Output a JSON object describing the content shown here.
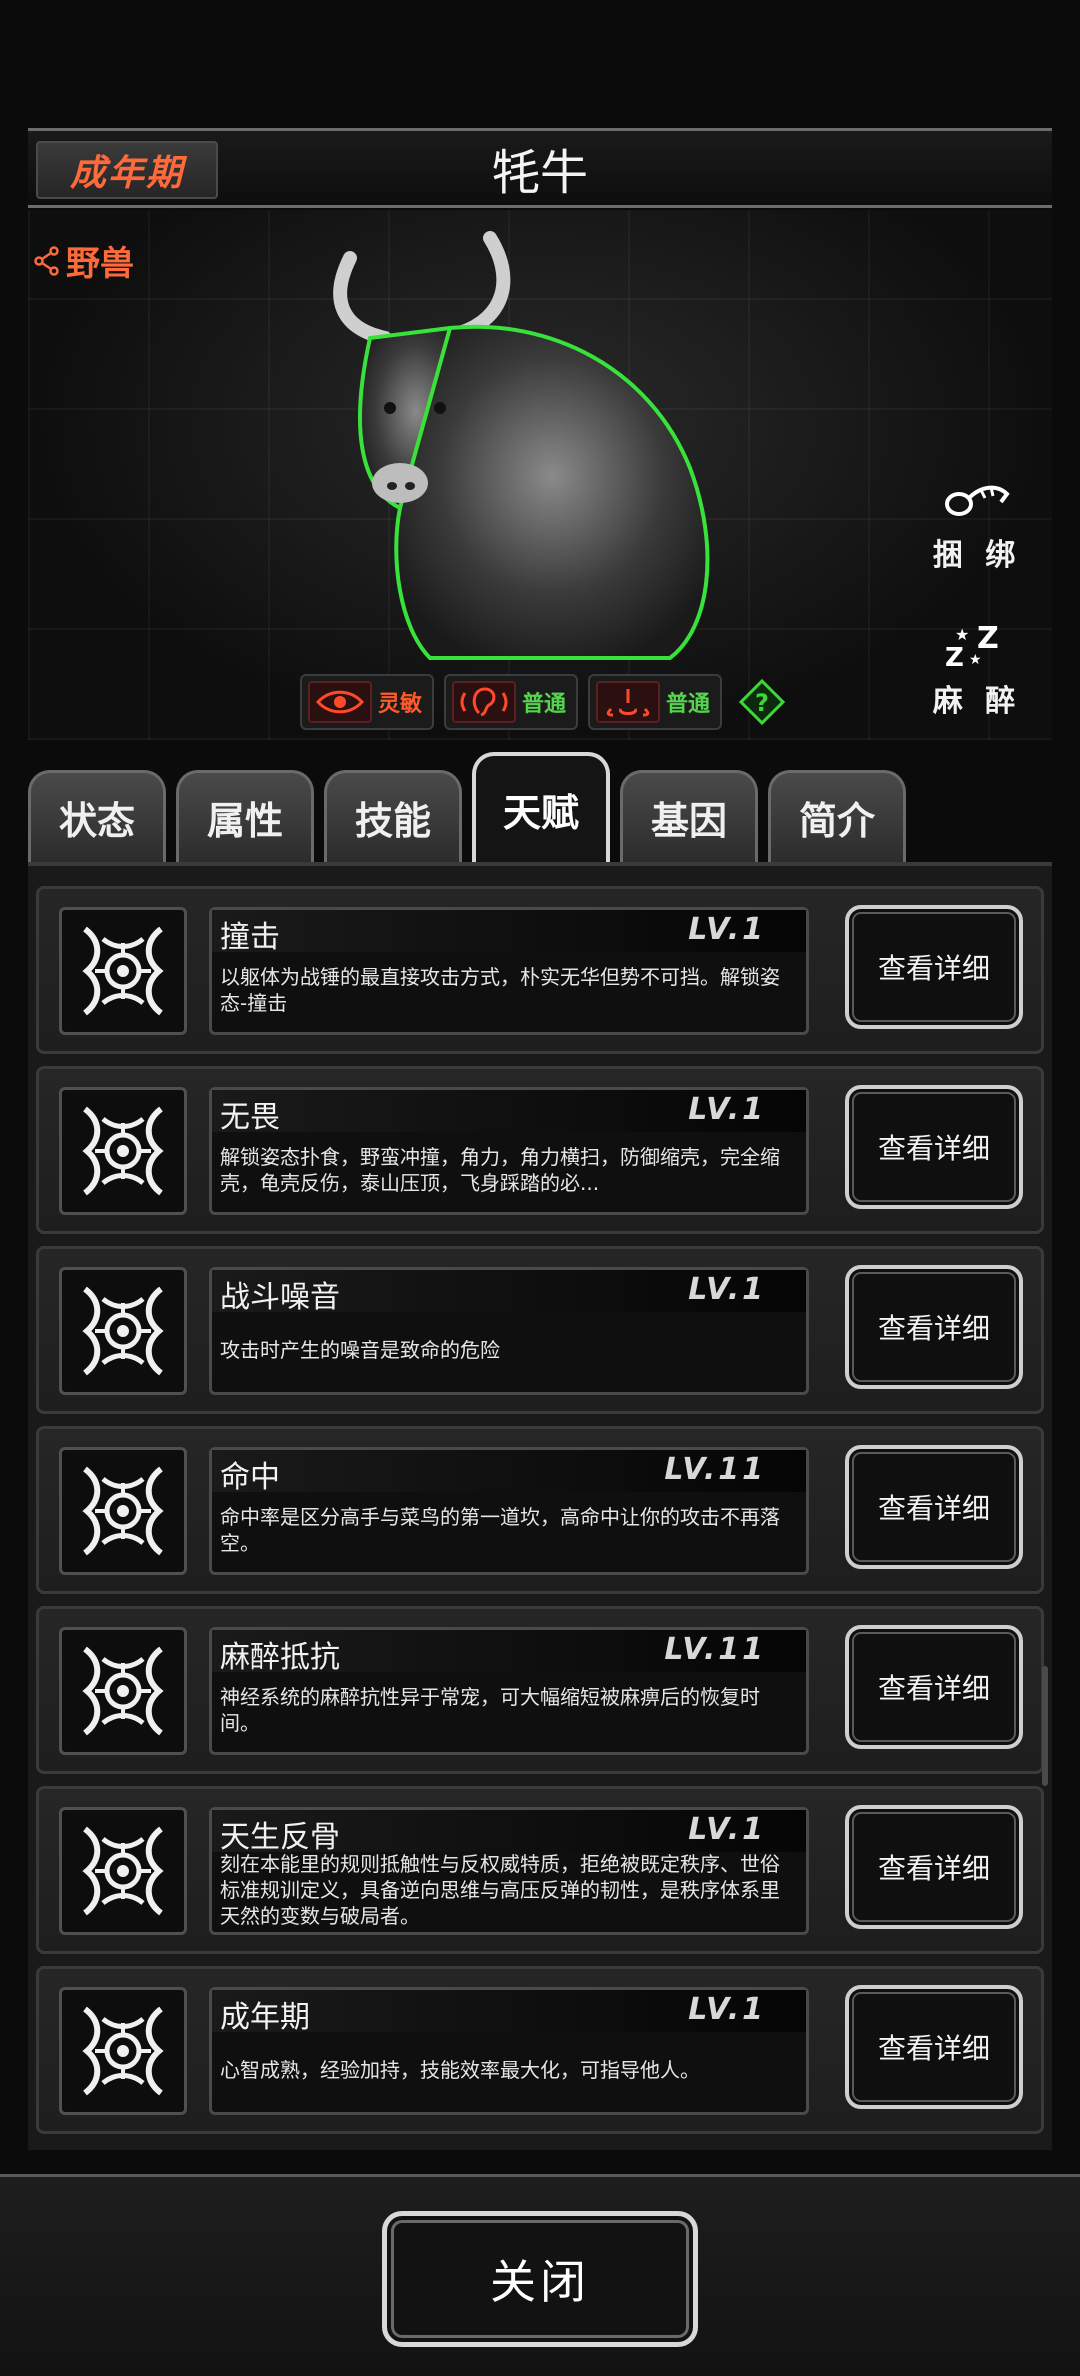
{
  "header": {
    "stage": "成年期",
    "title": "牦牛"
  },
  "hero": {
    "category": "野兽",
    "actions": [
      {
        "label": "捆 绑",
        "icon": "rope-icon"
      },
      {
        "label": "麻 醉",
        "icon": "sleep-icon"
      }
    ],
    "senses": [
      {
        "icon": "eye-icon",
        "label": "灵敏",
        "color": "#ff5a2a"
      },
      {
        "icon": "ear-icon",
        "label": "普通",
        "color": "#56d44e"
      },
      {
        "icon": "nose-icon",
        "label": "普通",
        "color": "#56d44e"
      }
    ]
  },
  "tabs": [
    {
      "label": "状态"
    },
    {
      "label": "属性"
    },
    {
      "label": "技能"
    },
    {
      "label": "天赋",
      "active": true
    },
    {
      "label": "基因"
    },
    {
      "label": "简介"
    }
  ],
  "talents": [
    {
      "name": "撞击",
      "level": "LV.1",
      "desc": "以躯体为战锤的最直接攻击方式，朴实无华但势不可挡。解锁姿态-撞击",
      "button": "查看详细"
    },
    {
      "name": "无畏",
      "level": "LV.1",
      "desc": "解锁姿态扑食，野蛮冲撞，角力，角力横扫，防御缩壳，完全缩壳，龟壳反伤，泰山压顶，飞身踩踏的必...",
      "button": "查看详细"
    },
    {
      "name": "战斗噪音",
      "level": "LV.1",
      "desc": "攻击时产生的噪音是致命的危险",
      "button": "查看详细"
    },
    {
      "name": "命中",
      "level": "LV.11",
      "desc": "命中率是区分高手与菜鸟的第一道坎，高命中让你的攻击不再落空。",
      "button": "查看详细"
    },
    {
      "name": "麻醉抵抗",
      "level": "LV.11",
      "desc": "神经系统的麻醉抗性异于常宠，可大幅缩短被麻痹后的恢复时间。",
      "button": "查看详细"
    },
    {
      "name": "天生反骨",
      "level": "LV.1",
      "desc": "刻在本能里的规则抵触性与反权威特质，拒绝被既定秩序、世俗标准规训定义，具备逆向思维与高压反弹的韧性，是秩序体系里天然的变数与破局者。",
      "button": "查看详细"
    },
    {
      "name": "成年期",
      "level": "LV.1",
      "desc": "心智成熟，经验加持，技能效率最大化，可指导他人。",
      "button": "查看详细"
    }
  ],
  "footer": {
    "close": "关闭"
  }
}
